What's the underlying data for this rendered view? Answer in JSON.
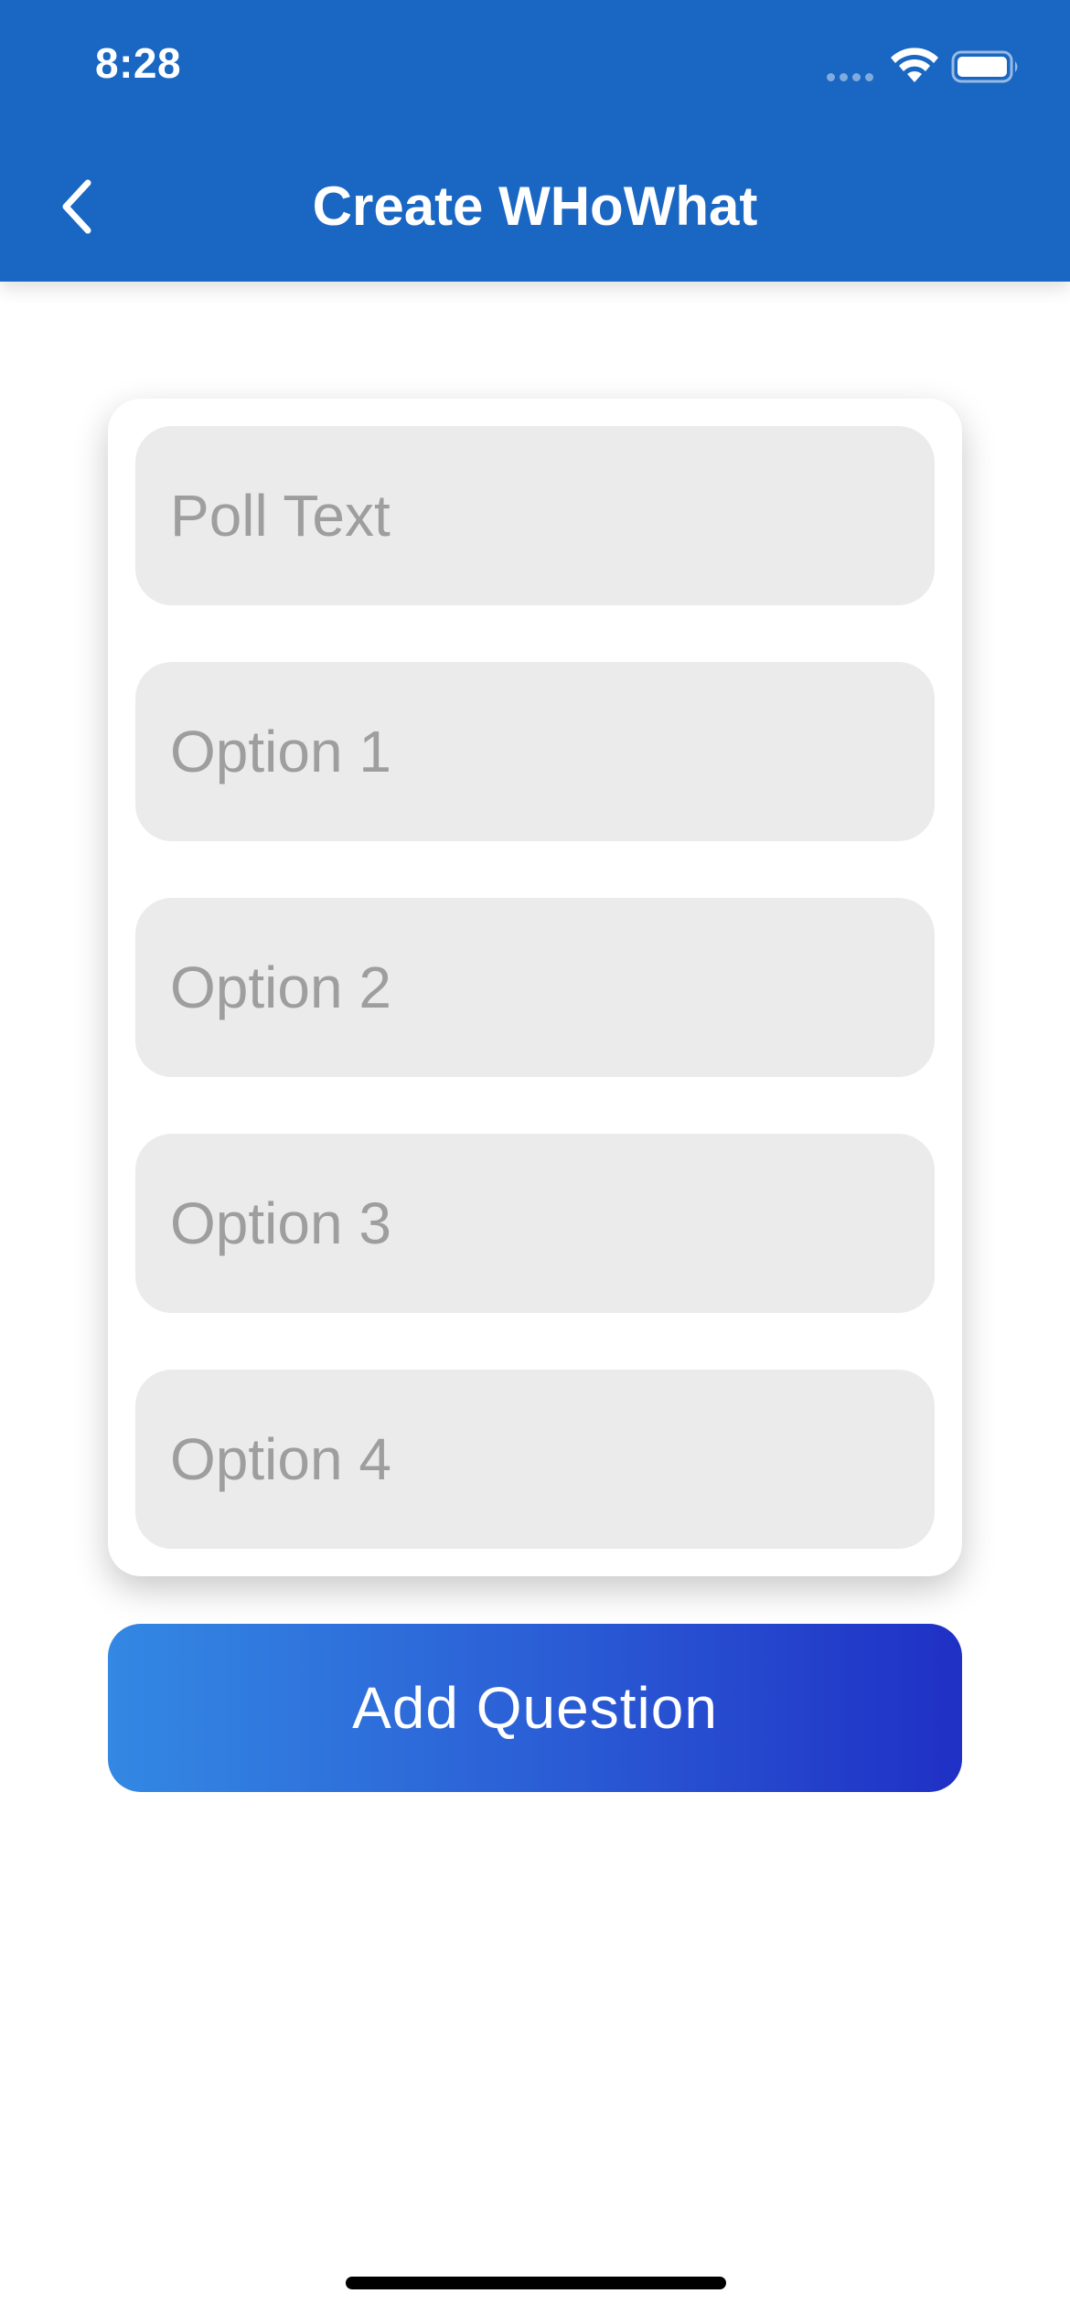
{
  "status_bar": {
    "time": "8:28"
  },
  "nav": {
    "title": "Create WHoWhat",
    "back_icon": "chevron-left-icon"
  },
  "form": {
    "poll_text": {
      "placeholder": "Poll Text",
      "value": ""
    },
    "options": [
      {
        "placeholder": "Option 1",
        "value": ""
      },
      {
        "placeholder": "Option 2",
        "value": ""
      },
      {
        "placeholder": "Option 3",
        "value": ""
      },
      {
        "placeholder": "Option 4",
        "value": ""
      }
    ]
  },
  "actions": {
    "add_question_label": "Add Question"
  },
  "colors": {
    "header": "#1966C3",
    "field_background": "#EBEBEB",
    "placeholder": "#9E9E9E",
    "button_gradient_start": "#3388E3",
    "button_gradient_end": "#1F30C5"
  }
}
